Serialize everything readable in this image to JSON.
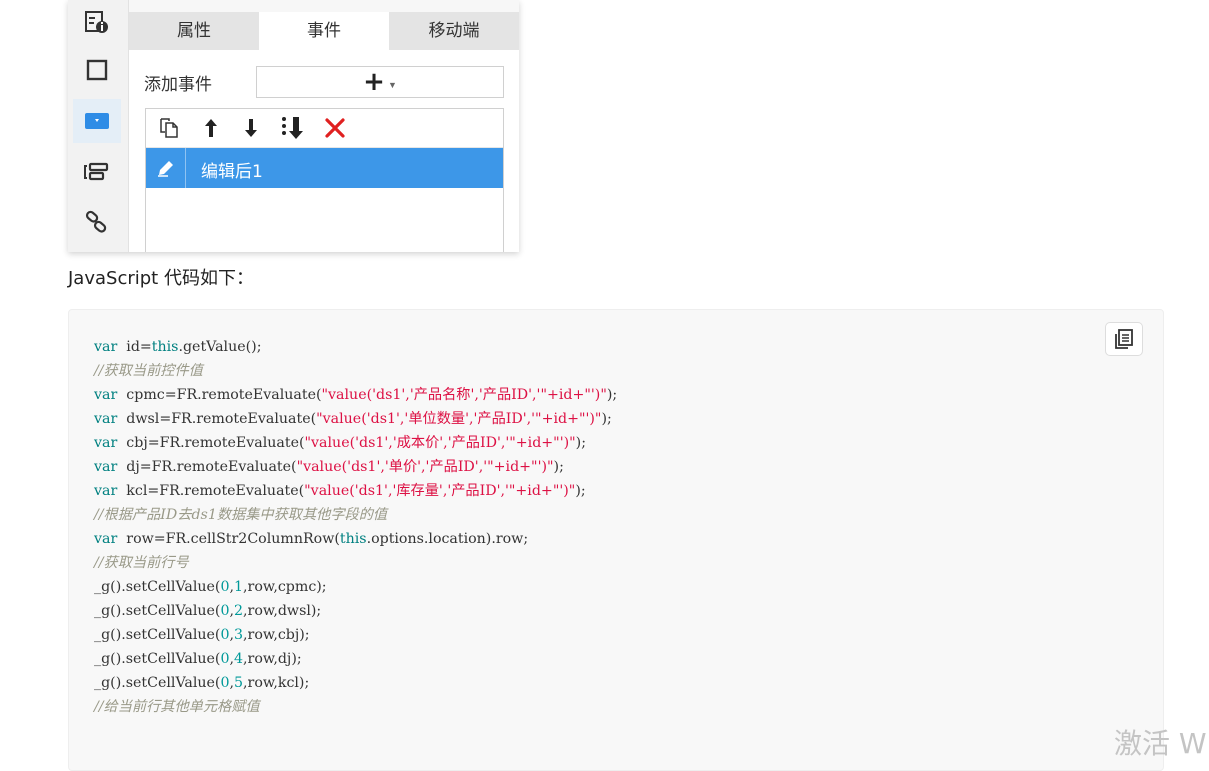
{
  "panel": {
    "tabs": [
      "属性",
      "事件",
      "移动端"
    ],
    "active_tab": "事件",
    "add_event_label": "添加事件",
    "add_button_symbol": "+",
    "toolbar_icons": [
      "copy-icon",
      "arrow-up-icon",
      "arrow-down-icon",
      "move-bottom-icon",
      "delete-icon"
    ],
    "event_item": "编辑后1",
    "sidebar_icons": [
      "widget-info-icon",
      "frame-icon",
      "dropdown-widget-icon",
      "list-widget-icon",
      "link-icon"
    ],
    "colors": {
      "accent": "#3d97e8",
      "delete": "#e02020"
    }
  },
  "intro_text": "JavaScript 代码如下：",
  "code": {
    "copy_icon": "copy-icon",
    "lines": [
      [
        [
          "kw",
          "var"
        ],
        [
          "t",
          "  id="
        ],
        [
          "kw",
          "this"
        ],
        [
          "t",
          ".getValue();"
        ]
      ],
      [
        [
          "cm",
          "//获取当前控件值"
        ]
      ],
      [
        [
          "kw",
          "var"
        ],
        [
          "t",
          "  cpmc=FR.remoteEvaluate("
        ],
        [
          "str",
          "\"value('ds1','产品名称','产品ID','\"+id+\"')\""
        ],
        [
          "t",
          ");"
        ]
      ],
      [
        [
          "kw",
          "var"
        ],
        [
          "t",
          "  dwsl=FR.remoteEvaluate("
        ],
        [
          "str",
          "\"value('ds1','单位数量','产品ID','\"+id+\"')\""
        ],
        [
          "t",
          ");"
        ]
      ],
      [
        [
          "kw",
          "var"
        ],
        [
          "t",
          "  cbj=FR.remoteEvaluate("
        ],
        [
          "str",
          "\"value('ds1','成本价','产品ID','\"+id+\"')\""
        ],
        [
          "t",
          ");"
        ]
      ],
      [
        [
          "kw",
          "var"
        ],
        [
          "t",
          "  dj=FR.remoteEvaluate("
        ],
        [
          "str",
          "\"value('ds1','单价','产品ID','\"+id+\"')\""
        ],
        [
          "t",
          ");"
        ]
      ],
      [
        [
          "kw",
          "var"
        ],
        [
          "t",
          "  kcl=FR.remoteEvaluate("
        ],
        [
          "str",
          "\"value('ds1','库存量','产品ID','\"+id+\"')\""
        ],
        [
          "t",
          ");"
        ]
      ],
      [
        [
          "cm",
          "//根据产品ID去ds1数据集中获取其他字段的值"
        ]
      ],
      [
        [
          "kw",
          "var"
        ],
        [
          "t",
          "  row=FR.cellStr2ColumnRow("
        ],
        [
          "kw",
          "this"
        ],
        [
          "t",
          ".options.location).row;"
        ]
      ],
      [
        [
          "cm",
          "//获取当前行号"
        ]
      ],
      [
        [
          "t",
          "_g().setCellValue("
        ],
        [
          "num",
          "0"
        ],
        [
          "t",
          ","
        ],
        [
          "num",
          "1"
        ],
        [
          "t",
          ",row,cpmc);"
        ]
      ],
      [
        [
          "t",
          "_g().setCellValue("
        ],
        [
          "num",
          "0"
        ],
        [
          "t",
          ","
        ],
        [
          "num",
          "2"
        ],
        [
          "t",
          ",row,dwsl);"
        ]
      ],
      [
        [
          "t",
          "_g().setCellValue("
        ],
        [
          "num",
          "0"
        ],
        [
          "t",
          ","
        ],
        [
          "num",
          "3"
        ],
        [
          "t",
          ",row,cbj);"
        ]
      ],
      [
        [
          "t",
          "_g().setCellValue("
        ],
        [
          "num",
          "0"
        ],
        [
          "t",
          ","
        ],
        [
          "num",
          "4"
        ],
        [
          "t",
          ",row,dj);"
        ]
      ],
      [
        [
          "t",
          "_g().setCellValue("
        ],
        [
          "num",
          "0"
        ],
        [
          "t",
          ","
        ],
        [
          "num",
          "5"
        ],
        [
          "t",
          ",row,kcl);"
        ]
      ],
      [
        [
          "cm",
          "//给当前行其他单元格赋值"
        ]
      ]
    ]
  },
  "watermark": "激活 W"
}
